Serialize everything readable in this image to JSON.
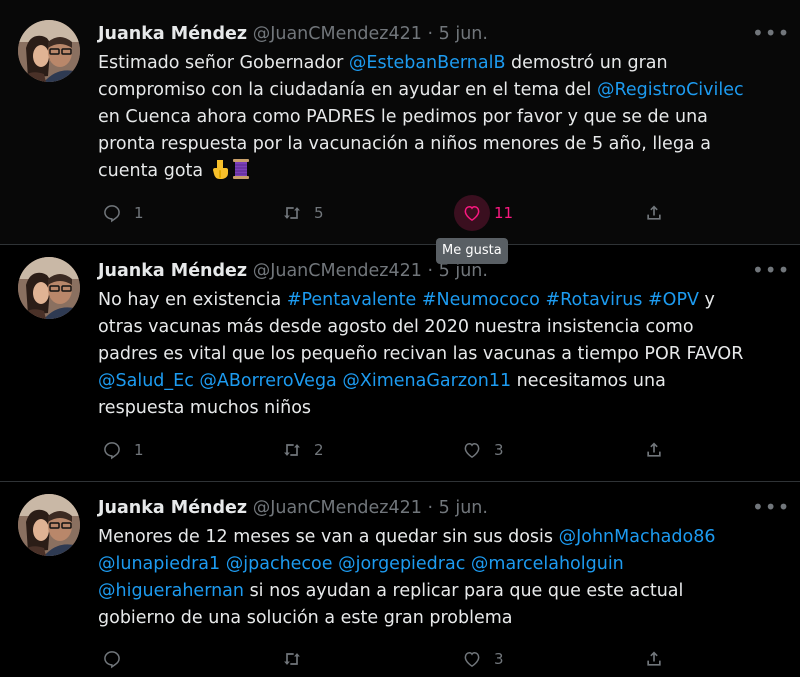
{
  "tweets": [
    {
      "author_name": "Juanka Méndez",
      "handle": "@JuanCMendez421",
      "separator": "·",
      "date": "5 jun.",
      "more": "•••",
      "lines": [
        [
          {
            "t": "Estimado señor Gobernador "
          },
          {
            "t": "@EstebanBernalB",
            "link": true
          },
          {
            "t": " demostró un gran"
          }
        ],
        [
          {
            "t": "compromiso con la ciudadanía en ayudar en el tema del "
          },
          {
            "t": "@RegistroCivilec",
            "link": true
          }
        ],
        [
          {
            "t": "en Cuenca ahora como PADRES le pedimos por favor y que se de una"
          }
        ],
        [
          {
            "t": "pronta respuesta por la vacunación a niños menores de 5 año, llega a"
          }
        ],
        [
          {
            "t": "cuenta gota "
          }
        ]
      ],
      "emojis": [
        "pointing-down-emoji",
        "spool-of-thread-emoji"
      ],
      "replies": "1",
      "retweets": "5",
      "likes": "11"
    },
    {
      "author_name": "Juanka Méndez",
      "handle": "@JuanCMendez421",
      "separator": "·",
      "date": "5 jun.",
      "more": "•••",
      "lines": [
        [
          {
            "t": "No hay en existencia "
          },
          {
            "t": "#Pentavalente",
            "link": true
          },
          {
            "t": " "
          },
          {
            "t": "#Neumococo",
            "link": true
          },
          {
            "t": " "
          },
          {
            "t": "#Rotavirus",
            "link": true
          },
          {
            "t": " "
          },
          {
            "t": "#OPV",
            "link": true
          },
          {
            "t": " y"
          }
        ],
        [
          {
            "t": "otras vacunas más desde agosto del 2020 nuestra insistencia como"
          }
        ],
        [
          {
            "t": "padres es vital que los pequeño recivan las vacunas a tiempo POR FAVOR"
          }
        ],
        [
          {
            "t": "@Salud_Ec",
            "link": true
          },
          {
            "t": " "
          },
          {
            "t": "@ABorreroVega",
            "link": true
          },
          {
            "t": " "
          },
          {
            "t": "@XimenaGarzon11",
            "link": true
          },
          {
            "t": " necesitamos una"
          }
        ],
        [
          {
            "t": "respuesta muchos niños"
          }
        ]
      ],
      "replies": "1",
      "retweets": "2",
      "likes": "3"
    },
    {
      "author_name": "Juanka Méndez",
      "handle": "@JuanCMendez421",
      "separator": "·",
      "date": "5 jun.",
      "more": "•••",
      "lines": [
        [
          {
            "t": "Menores de 12 meses se van a quedar sin sus dosis "
          },
          {
            "t": "@JohnMachado86",
            "link": true
          }
        ],
        [
          {
            "t": "@lunapiedra1",
            "link": true
          },
          {
            "t": " "
          },
          {
            "t": "@jpachecoe",
            "link": true
          },
          {
            "t": " "
          },
          {
            "t": "@jorgepiedrac",
            "link": true
          },
          {
            "t": " "
          },
          {
            "t": "@marcelaholguin",
            "link": true
          }
        ],
        [
          {
            "t": "@higuerahernan",
            "link": true
          },
          {
            "t": " si nos ayudan a replicar para que que este actual"
          }
        ],
        [
          {
            "t": "gobierno de una solución a este gran problema"
          }
        ]
      ],
      "replies": "",
      "retweets": "",
      "likes": "3"
    }
  ],
  "tooltip": "Me gusta",
  "colors": {
    "background": "#000000",
    "text": "#e7e9ea",
    "muted": "#71767b",
    "link": "#1d9bf0",
    "like": "#f91880"
  },
  "icons": {
    "reply": "reply-icon",
    "retweet": "retweet-icon",
    "like": "heart-icon",
    "share": "share-icon"
  }
}
